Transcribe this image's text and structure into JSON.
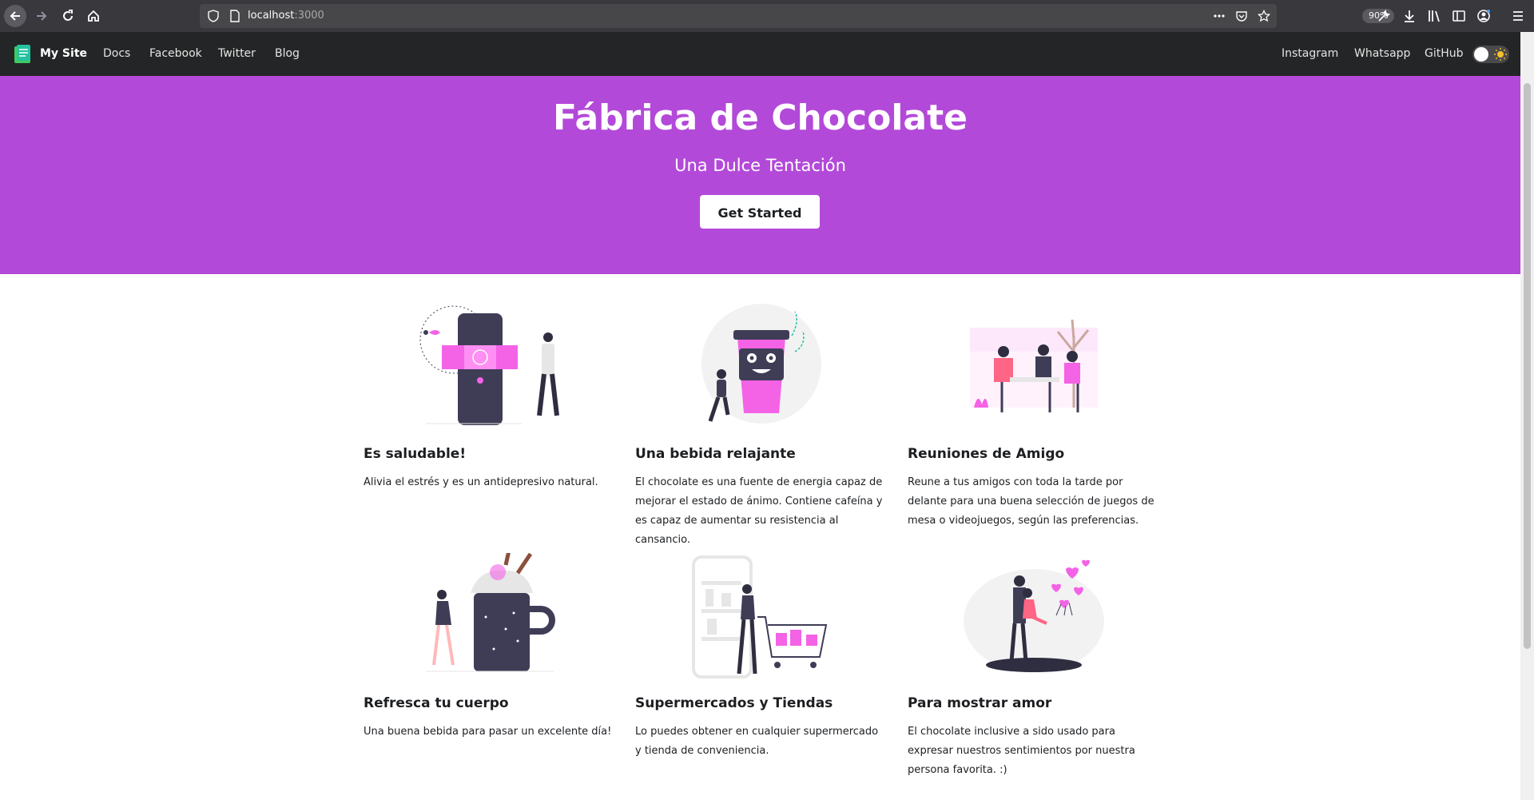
{
  "browser": {
    "url_host": "localhost",
    "url_port": ":3000",
    "zoom": "90%"
  },
  "navbar": {
    "brand": "My Site",
    "left_links": [
      "Docs",
      "Facebook",
      "Twitter",
      "Blog"
    ],
    "right_links": [
      "Instagram",
      "Whatsapp",
      "GitHub"
    ]
  },
  "hero": {
    "title": "Fábrica de Chocolate",
    "subtitle": "Una Dulce Tentación",
    "cta": "Get Started",
    "background": "#b349d9"
  },
  "features": [
    {
      "title": "Es saludable!",
      "text": "Alivia el estrés y es un antidepresivo natural."
    },
    {
      "title": "Una bebida relajante",
      "text": "El chocolate es una fuente de energia capaz de mejorar el estado de ánimo. Contiene cafeína y es capaz de aumentar su resistencia al cansancio."
    },
    {
      "title": "Reuniones de Amigo",
      "text": "Reune a tus amigos con toda la tarde por delante para una buena selección de juegos de mesa o videojuegos, según las preferencias."
    },
    {
      "title": "Refresca tu cuerpo",
      "text": "Una buena bebida para pasar un excelente día!"
    },
    {
      "title": "Supermercados y Tiendas",
      "text": "Lo puedes obtener en cualquier supermercado y tienda de conveniencia."
    },
    {
      "title": "Para mostrar amor",
      "text": "El chocolate inclusive a sido usado para expresar nuestros sentimientos por nuestra persona favorita. :)"
    }
  ],
  "colors": {
    "accent": "#f462e6",
    "dark": "#3f3d56",
    "navbar": "#242526"
  }
}
